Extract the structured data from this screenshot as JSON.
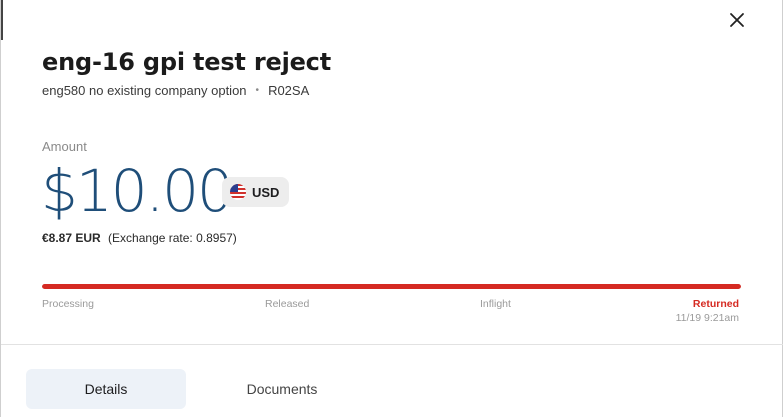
{
  "header": {
    "title": "eng-16 gpi test reject",
    "subtitle_left": "eng580 no existing company option",
    "subtitle_separator": "•",
    "subtitle_right": "R02SA",
    "close_icon": "close-icon"
  },
  "amount": {
    "label": "Amount",
    "value": "$10.00",
    "currency": "USD",
    "flag_icon": "us-flag-icon",
    "converted": "€8.87 EUR",
    "exchange_rate_text": "(Exchange rate: 0.8957)"
  },
  "progress": {
    "percent": 100,
    "color": "#d52a22",
    "steps": [
      {
        "label": "Processing"
      },
      {
        "label": "Released"
      },
      {
        "label": "Inflight"
      },
      {
        "label": "Returned",
        "timestamp": "11/19 9:21am",
        "active": true
      }
    ]
  },
  "tabs": [
    {
      "label": "Details",
      "active": true
    },
    {
      "label": "Documents",
      "active": false
    }
  ],
  "colors": {
    "amount": "#1f4e79",
    "accent_red": "#d52a22",
    "active_tab_bg": "#edf2f8"
  }
}
